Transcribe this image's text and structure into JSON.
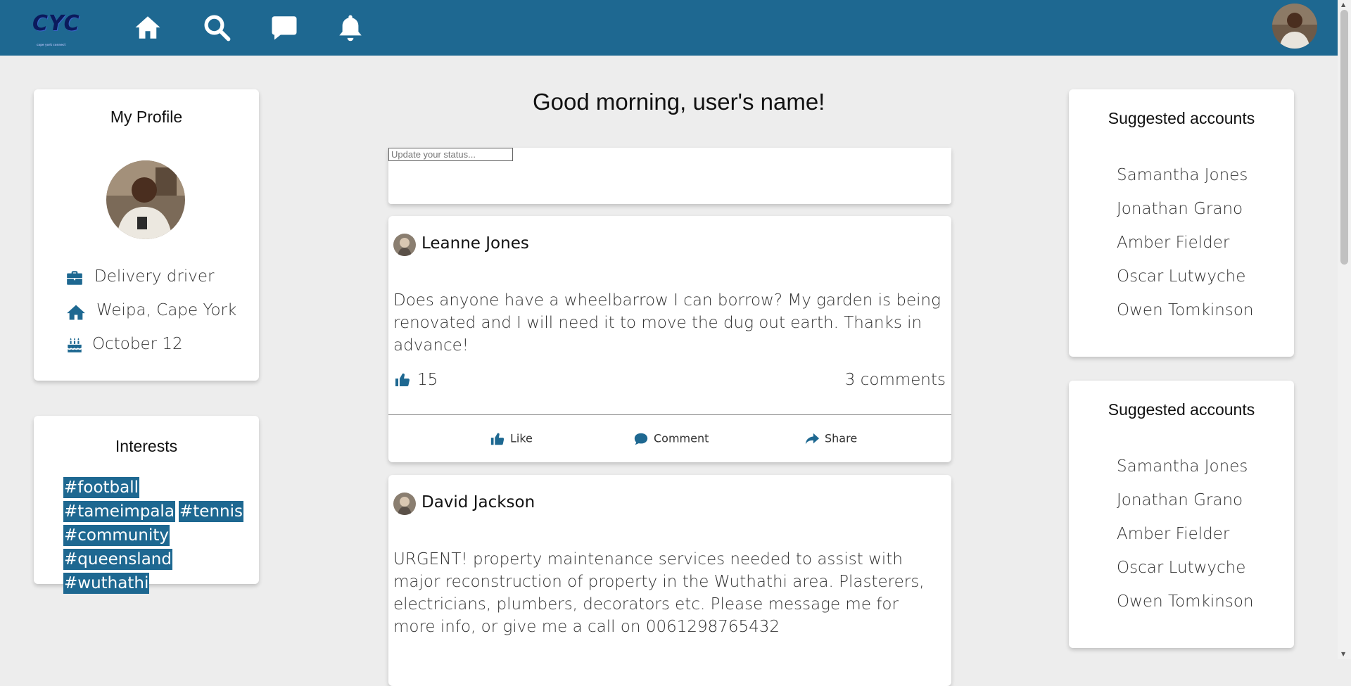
{
  "nav": {
    "logo_text": "CYC",
    "logo_tagline": "cape york connect",
    "icons": [
      "home-icon",
      "search-icon",
      "chat-icon",
      "bell-icon"
    ]
  },
  "profile": {
    "title": "My Profile",
    "job": "Delivery driver",
    "location": "Weipa, Cape York",
    "birthday": "October 12"
  },
  "interests": {
    "title": "Interests",
    "tags": [
      "#football",
      "#tameimpala",
      "#tennis",
      "#community",
      "#queensland",
      "#wuthathi"
    ]
  },
  "feed": {
    "greeting": "Good morning, user's name!",
    "status_placeholder": "Update your status...",
    "posts": [
      {
        "author": "Leanne Jones",
        "body": "Does anyone have a wheelbarrow I can borrow? My garden is being renovated and I will need it to move the dug out earth. Thanks in advance!",
        "likes": "15",
        "comments": "3 comments",
        "like_label": "Like",
        "comment_label": "Comment",
        "share_label": "Share"
      },
      {
        "author": "David Jackson",
        "body": "URGENT! property maintenance services needed to assist with major reconstruction of property in the Wuthathi area. Plasterers, electricians, plumbers, decorators etc. Please message me for more info, or give me a call on 0061298765432"
      }
    ]
  },
  "suggested": [
    {
      "title": "Suggested accounts",
      "names": [
        "Samantha Jones",
        "Jonathan Grano",
        "Amber Fielder",
        "Oscar Lutwyche",
        "Owen Tomkinson"
      ]
    },
    {
      "title": "Suggested accounts",
      "names": [
        "Samantha Jones",
        "Jonathan Grano",
        "Amber Fielder",
        "Oscar Lutwyche",
        "Owen Tomkinson"
      ]
    }
  ],
  "colors": {
    "brand": "#1e6891",
    "background": "#ededed"
  }
}
